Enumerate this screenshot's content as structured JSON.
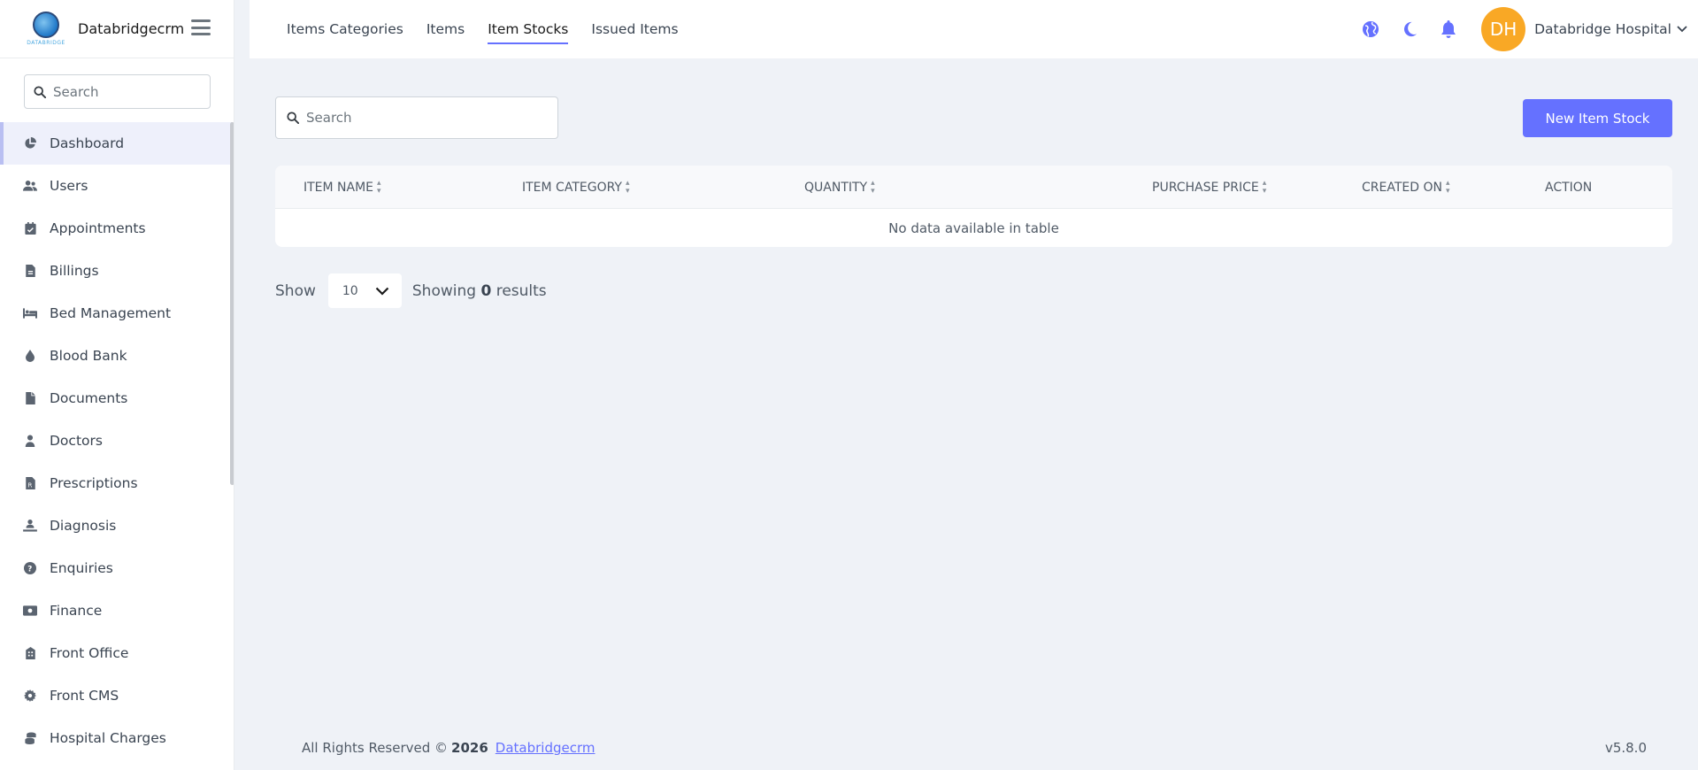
{
  "brand": {
    "name": "Databridgecrm",
    "logo_text": "DATABRIDGE"
  },
  "sidebar": {
    "search_placeholder": "Search",
    "items": [
      {
        "label": "Dashboard",
        "icon": "chart-pie-icon"
      },
      {
        "label": "Users",
        "icon": "users-icon"
      },
      {
        "label": "Appointments",
        "icon": "calendar-check-icon"
      },
      {
        "label": "Billings",
        "icon": "file-invoice-icon"
      },
      {
        "label": "Bed Management",
        "icon": "bed-icon"
      },
      {
        "label": "Blood Bank",
        "icon": "droplet-icon"
      },
      {
        "label": "Documents",
        "icon": "file-icon"
      },
      {
        "label": "Doctors",
        "icon": "user-doctor-icon"
      },
      {
        "label": "Prescriptions",
        "icon": "file-prescription-icon"
      },
      {
        "label": "Diagnosis",
        "icon": "diagnoses-icon"
      },
      {
        "label": "Enquiries",
        "icon": "question-circle-icon"
      },
      {
        "label": "Finance",
        "icon": "money-bill-icon"
      },
      {
        "label": "Front Office",
        "icon": "building-icon"
      },
      {
        "label": "Front CMS",
        "icon": "gear-icon"
      },
      {
        "label": "Hospital Charges",
        "icon": "coins-icon"
      }
    ]
  },
  "topbar": {
    "tabs": [
      {
        "label": "Items Categories"
      },
      {
        "label": "Items"
      },
      {
        "label": "Item Stocks"
      },
      {
        "label": "Issued Items"
      }
    ],
    "user_initials": "DH",
    "user_name": "Databridge Hospital"
  },
  "main": {
    "search_placeholder": "Search",
    "new_button": "New Item Stock",
    "table": {
      "columns": [
        "ITEM NAME",
        "ITEM CATEGORY",
        "QUANTITY",
        "PURCHASE PRICE",
        "CREATED ON",
        "ACTION"
      ],
      "empty_text": "No data available in table"
    },
    "pager": {
      "show_label": "Show",
      "page_size": "10",
      "showing_prefix": "Showing",
      "showing_count": "0",
      "showing_suffix": "results"
    }
  },
  "footer": {
    "rights": "All Rights Reserved ©",
    "year": "2026",
    "link": "Databridgecrm",
    "version": "v5.8.0"
  },
  "colors": {
    "primary": "#6571ff",
    "avatar": "#f9a825",
    "background": "#eff2f7"
  }
}
